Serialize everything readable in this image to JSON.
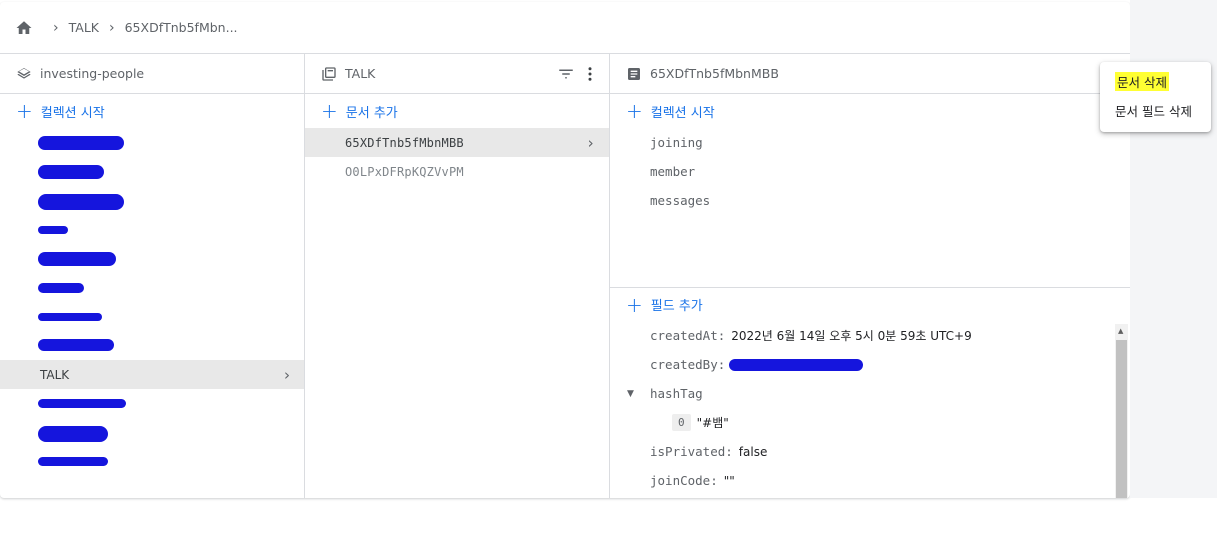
{
  "breadcrumb": {
    "items": [
      "TALK",
      "65XDfTnb5fMbn..."
    ]
  },
  "col1": {
    "header": "investing-people",
    "add_label": "컬렉션 시작",
    "items": [
      {
        "label": "",
        "redacted": true
      },
      {
        "label": "",
        "redacted": true
      },
      {
        "label": "",
        "redacted": true
      },
      {
        "label": "",
        "redacted": true
      },
      {
        "label": "",
        "redacted": true
      },
      {
        "label": "",
        "redacted": true
      },
      {
        "label": "",
        "redacted": true
      },
      {
        "label": "",
        "redacted": true
      },
      {
        "label": "TALK",
        "selected": true
      },
      {
        "label": "",
        "redacted": true
      },
      {
        "label": "",
        "redacted": true
      },
      {
        "label": "",
        "redacted": true
      }
    ]
  },
  "col2": {
    "header": "TALK",
    "add_label": "문서 추가",
    "docs": [
      "65XDfTnb5fMbnMBB",
      "O0LPxDFRpKQZVvPM"
    ]
  },
  "col3": {
    "header": "65XDfTnb5fMbnMBB",
    "add_collection_label": "컬렉션 시작",
    "subcollections": [
      "joining",
      "member",
      "messages"
    ],
    "add_field_label": "필드 추가",
    "fields": {
      "createdAt_key": "createdAt:",
      "createdAt_val": "2022년 6월 14일 오후 5시 0분 59초 UTC+9",
      "createdBy_key": "createdBy:",
      "hashTag_key": "hashTag",
      "hashTag_index": "0",
      "hashTag_val": "\"#뱀\"",
      "isPrivated_key": "isPrivated:",
      "isPrivated_val": "false",
      "joinCode_key": "joinCode:",
      "joinCode_val": "\"\""
    }
  },
  "context_menu": {
    "items": [
      "문서 삭제",
      "문서 필드 삭제"
    ]
  },
  "colors": {
    "accent": "#1a73e8",
    "redaction": "#1515dd",
    "highlight": "#ffff33",
    "selected_row": "#e8e8e8"
  },
  "icons": [
    "home-icon",
    "chevron-right-icon",
    "project-layers-icon",
    "collection-icon",
    "filter-icon",
    "more-vert-icon",
    "document-icon",
    "add-icon",
    "caret-down-icon"
  ]
}
